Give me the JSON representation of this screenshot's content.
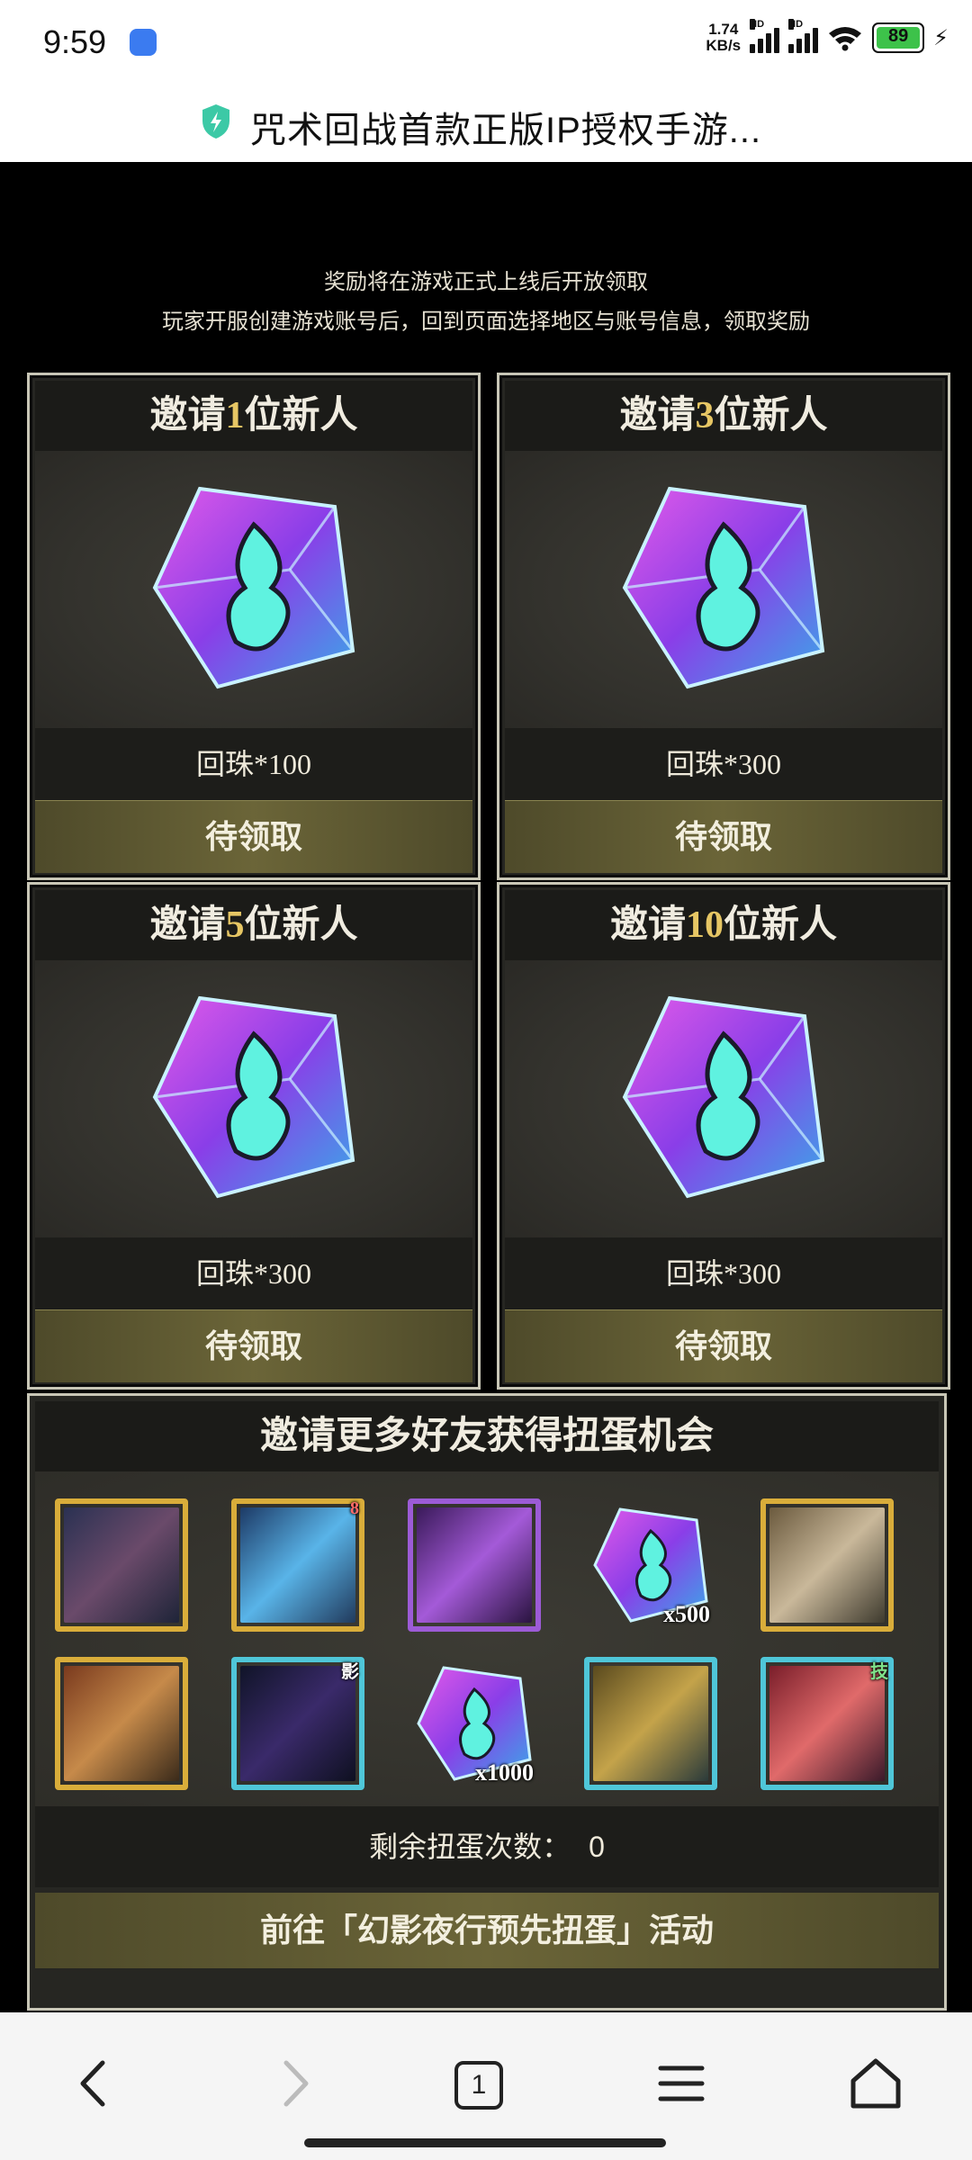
{
  "status_bar": {
    "time": "9:59",
    "net_rate_value": "1.74",
    "net_rate_unit": "KB/s",
    "hd1": "HD",
    "hd2": "HD",
    "battery": "89"
  },
  "title_bar": {
    "title": "咒术回战首款正版IP授权手游..."
  },
  "notice": {
    "line1": "奖励将在游戏正式上线后开放领取",
    "line2": "玩家开服创建游戏账号后，回到页面选择地区与账号信息，领取奖励"
  },
  "cards": [
    {
      "prefix": "邀请",
      "count": "1",
      "suffix": "位新人",
      "reward": "回珠*100",
      "button": "待领取"
    },
    {
      "prefix": "邀请",
      "count": "3",
      "suffix": "位新人",
      "reward": "回珠*300",
      "button": "待领取"
    },
    {
      "prefix": "邀请",
      "count": "5",
      "suffix": "位新人",
      "reward": "回珠*300",
      "button": "待领取"
    },
    {
      "prefix": "邀请",
      "count": "10",
      "suffix": "位新人",
      "reward": "回珠*300",
      "button": "待领取"
    }
  ],
  "gacha": {
    "title": "邀请更多好友获得扭蛋机会",
    "items": [
      {
        "icon": "character-card-1"
      },
      {
        "icon": "character-card-2",
        "badge": "8"
      },
      {
        "icon": "character-card-3"
      },
      {
        "icon": "cube-item",
        "qty": "x500"
      },
      {
        "icon": "character-card-4"
      },
      {
        "icon": "character-card-5"
      },
      {
        "icon": "character-card-6",
        "badge": "影"
      },
      {
        "icon": "cube-item",
        "qty": "x1000"
      },
      {
        "icon": "character-card-7"
      },
      {
        "icon": "character-card-8",
        "badge": "技"
      }
    ],
    "remaining_label": "剩余扭蛋次数：",
    "remaining_value": "0",
    "button": "前往「幻影夜行预先扭蛋」活动"
  },
  "nav": {
    "tab_count": "1"
  },
  "colors": {
    "accent_gold": "#e6c664",
    "battery_green": "#3dc24a"
  }
}
